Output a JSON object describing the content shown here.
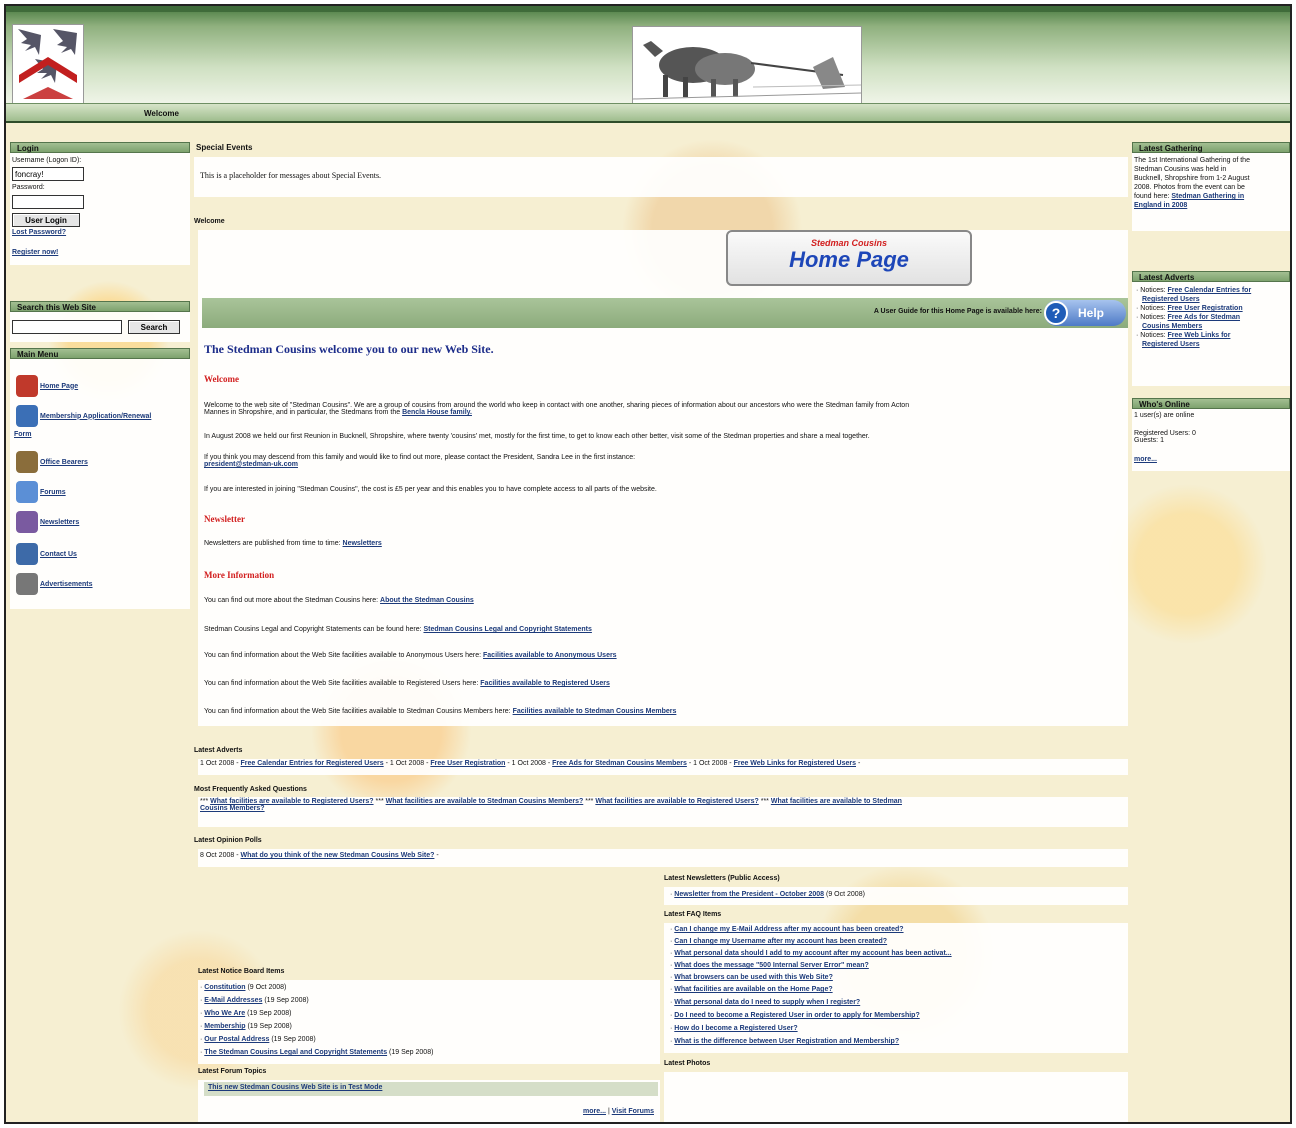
{
  "nav": {
    "welcome": "Welcome"
  },
  "login": {
    "title": "Login",
    "username_label": "Username (Logon ID):",
    "username_value": "foncray!",
    "password_label": "Password:",
    "button": "User Login",
    "lost_password": "Lost Password?",
    "register": "Register now!"
  },
  "search": {
    "title": "Search this Web Site",
    "button": "Search"
  },
  "main_menu": {
    "title": "Main Menu",
    "items": [
      {
        "label": "Home Page",
        "icon": "home-icon",
        "color": "#c0392b"
      },
      {
        "label": "Membership Application/Renewal",
        "icon": "membership-icon",
        "color": "#3b6fb6"
      },
      {
        "label": "Form",
        "icon": "",
        "color": ""
      },
      {
        "label": "Office Bearers",
        "icon": "people-icon",
        "color": "#8a6d3b"
      },
      {
        "label": "Forums",
        "icon": "forum-icon",
        "color": "#5b8fd6"
      },
      {
        "label": "Newsletters",
        "icon": "newsletter-icon",
        "color": "#7a5aa0"
      },
      {
        "label": "Contact Us",
        "icon": "contact-icon",
        "color": "#3d6aa8"
      },
      {
        "label": "Advertisements",
        "icon": "advert-icon",
        "color": "#777"
      }
    ]
  },
  "special_events": {
    "title": "Special Events",
    "text": "This is a placeholder for messages about Special Events."
  },
  "welcome_section": {
    "title": "Welcome",
    "hp_small": "Stedman Cousins",
    "hp_big": "Home Page",
    "guide_text": "A User Guide for this Home Page is available here:",
    "help_button": "Help",
    "heading": "The Stedman Cousins welcome you to our new Web Site.",
    "welcome_head": "Welcome",
    "p1a": "Welcome to the web site of \"Stedman Cousins\".   We are a group of cousins from around the world who keep in contact with one another, sharing pieces of information about our ancestors who were the Stedman family from Acton",
    "p1b": "Mannes in Shropshire, and in particular, the Stedmans from the",
    "p1_link": "Bencla House family.",
    "p2": "In August 2008 we held our first Reunion in Bucknell, Shropshire, where twenty 'cousins' met, mostly for the first time, to get to know each other better, visit some of the Stedman properties and share a meal together.",
    "p3": "If you think you may descend from this family and would like to find out more, please contact the President, Sandra Lee in the first instance:",
    "p3_link": "president@stedman-uk.com",
    "p4": "If you are interested in joining \"Stedman Cousins\", the cost is £5 per year and this enables you to have complete access to all parts of the website.",
    "news_head": "Newsletter",
    "p5": "Newsletters are published from time to time:",
    "p5_link": "Newsletters",
    "more_head": "More Information",
    "p6": "You can find out more about the Stedman Cousins here:",
    "p6_link": "About the Stedman Cousins",
    "p7": "Stedman Cousins Legal and Copyright Statements can be found here:",
    "p7_link": "Stedman Cousins Legal and Copyright Statements",
    "p8": "You can find information about the Web Site facilities available to Anonymous Users here:",
    "p8_link": "Facilities available to Anonymous Users",
    "p9": "You can find information about the Web Site facilities available to Registered Users here:",
    "p9_link": "Facilities available to Registered Users",
    "p10": "You can find information about the Web Site facilities available to Stedman Cousins Members here:",
    "p10_link": "Facilities available to Stedman Cousins Members"
  },
  "latest_adverts_bottom": {
    "title": "Latest Adverts",
    "d1": "1 Oct 2008 -",
    "l1": "Free Calendar Entries for Registered Users",
    "d2": "- 1 Oct 2008 -",
    "l2": "Free User Registration",
    "d3": "- 1 Oct 2008 -",
    "l3": "Free Ads for Stedman Cousins Members",
    "d4": "- 1 Oct 2008 -",
    "l4": "Free Web Links for Registered Users",
    "end": "-"
  },
  "faq_most": {
    "title": "Most Frequently Asked Questions",
    "s1": "***",
    "q1": "What facilities are available to Registered Users?",
    "s2": "***",
    "q2": "What facilities are available to Stedman Cousins Members?",
    "s3": "***",
    "q3": "What facilities are available to Registered Users?",
    "s4": "***",
    "q4a": "What facilities are available to Stedman",
    "q4b": "Cousins Members?"
  },
  "polls": {
    "title": "Latest Opinion Polls",
    "date": "8 Oct 2008 -",
    "link": "What do you think of the new Stedman Cousins Web Site?",
    "end": "-"
  },
  "notice_board": {
    "title": "Latest Notice Board Items",
    "items": [
      {
        "label": "Constitution",
        "date": "(9 Oct 2008)"
      },
      {
        "label": "E-Mail Addresses",
        "date": "(19 Sep 2008)"
      },
      {
        "label": "Who We Are",
        "date": "(19 Sep 2008)"
      },
      {
        "label": "Membership",
        "date": "(19 Sep 2008)"
      },
      {
        "label": "Our Postal Address",
        "date": "(19 Sep 2008)"
      },
      {
        "label": "The Stedman Cousins Legal and Copyright Statements",
        "date": "(19 Sep 2008)"
      }
    ]
  },
  "forum_topics": {
    "title": "Latest Forum Topics",
    "topic": "This new Stedman Cousins Web Site is in Test Mode",
    "more": "more...",
    "sep": "|",
    "visit": "Visit Forums"
  },
  "newsletters_public": {
    "title": "Latest Newsletters (Public Access)",
    "link": "Newsletter from the President - October 2008",
    "date": "(9 Oct 2008)"
  },
  "faq_latest": {
    "title": "Latest FAQ Items",
    "items": [
      "Can I change my E-Mail Address after my account has been created?",
      "Can I change my Username after my account has been created?",
      "What personal data should I add to my account after my account has been activat...",
      "What does the message \"500 Internal Server Error\" mean?",
      "What browsers can be used with this Web Site?",
      "What facilities are available on the Home Page?",
      "What personal data do I need to supply when I register?",
      "Do I need to become a Registered User in order to apply for Membership?",
      "How do I become a Registered User?",
      "What is the difference between User Registration and Membership?"
    ]
  },
  "photos": {
    "title": "Latest Photos"
  },
  "gathering": {
    "title": "Latest Gathering",
    "l1": "The 1st International Gathering of the",
    "l2": "Stedman Cousins was held in",
    "l3": "Bucknell, Shropshire from 1-2 August",
    "l4": "2008.  Photos from the event can be",
    "l5": "found here:",
    "link1": "Stedman Gathering in",
    "link2": "England in 2008"
  },
  "adverts_right": {
    "title": "Latest Adverts",
    "items": [
      {
        "prefix": "Notices:",
        "a": "Free Calendar Entries for",
        "b": "Registered Users"
      },
      {
        "prefix": "Notices:",
        "a": "Free User Registration",
        "b": ""
      },
      {
        "prefix": "Notices:",
        "a": "Free Ads for Stedman",
        "b": "Cousins Members"
      },
      {
        "prefix": "Notices:",
        "a": "Free Web Links for",
        "b": "Registered Users"
      }
    ]
  },
  "whos_online": {
    "title": "Who's Online",
    "users_online": "1 user(s) are online",
    "registered": "Registered Users: 0",
    "guests": "Guests: 1",
    "more": "more..."
  }
}
